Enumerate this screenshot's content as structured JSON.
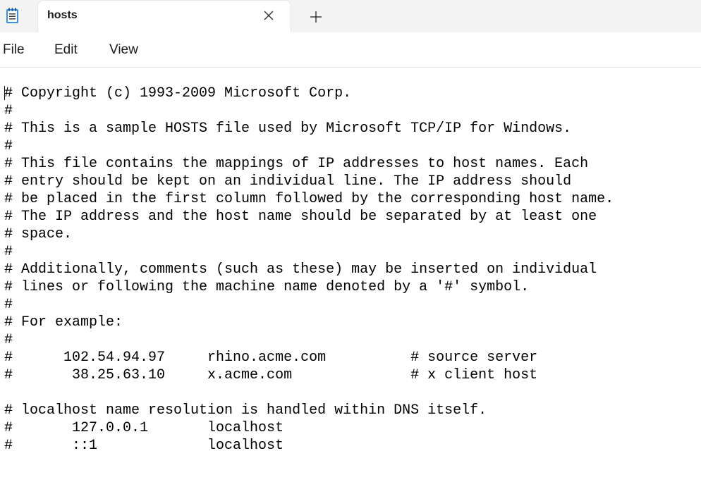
{
  "window": {
    "tab_title": "hosts"
  },
  "menu": {
    "file": "File",
    "edit": "Edit",
    "view": "View"
  },
  "icons": {
    "app": "notepad-icon",
    "close": "close-icon",
    "new_tab": "plus-icon"
  },
  "colors": {
    "tabbar_bg": "#f3f3f3",
    "accent": "#3a8ee6"
  },
  "editor": {
    "lines": [
      "# Copyright (c) 1993-2009 Microsoft Corp.",
      "#",
      "# This is a sample HOSTS file used by Microsoft TCP/IP for Windows.",
      "#",
      "# This file contains the mappings of IP addresses to host names. Each",
      "# entry should be kept on an individual line. The IP address should",
      "# be placed in the first column followed by the corresponding host name.",
      "# The IP address and the host name should be separated by at least one",
      "# space.",
      "#",
      "# Additionally, comments (such as these) may be inserted on individual",
      "# lines or following the machine name denoted by a '#' symbol.",
      "#",
      "# For example:",
      "#",
      "#      102.54.94.97     rhino.acme.com          # source server",
      "#       38.25.63.10     x.acme.com              # x client host",
      "",
      "# localhost name resolution is handled within DNS itself.",
      "#\t127.0.0.1       localhost",
      "#\t::1             localhost"
    ]
  }
}
